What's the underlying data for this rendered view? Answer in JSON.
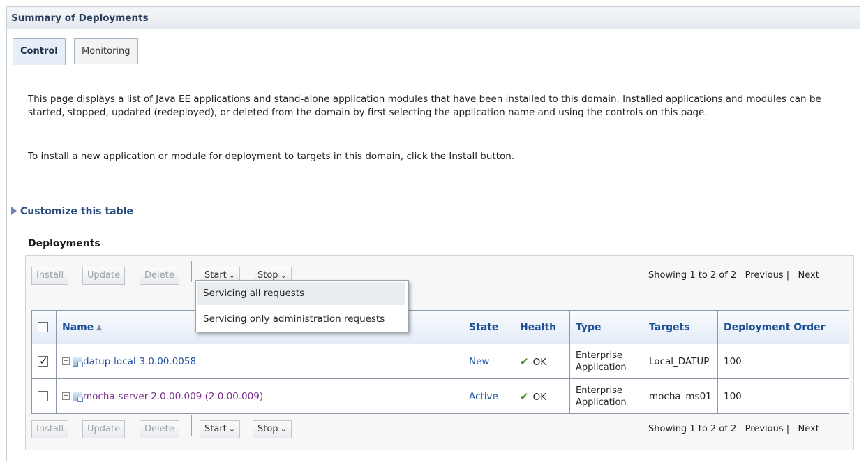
{
  "header": {
    "title": "Summary of Deployments"
  },
  "tabs": [
    {
      "label": "Control",
      "active": true
    },
    {
      "label": "Monitoring",
      "active": false
    }
  ],
  "description": {
    "paragraph1": "This page displays a list of Java EE applications and stand-alone application modules that have been installed to this domain. Installed applications and modules can be started, stopped, updated (redeployed), or deleted from the domain by first selecting the application name and using the controls on this page.",
    "paragraph2": "To install a new application or module for deployment to targets in this domain, click the Install button."
  },
  "customize_link": "Customize this table",
  "section_title": "Deployments",
  "toolbar": {
    "install": "Install",
    "update": "Update",
    "delete": "Delete",
    "start": "Start",
    "stop": "Stop",
    "chevron": "⌄"
  },
  "paging": {
    "showing": "Showing 1 to 2 of 2",
    "previous": "Previous",
    "separator": "|",
    "next": "Next"
  },
  "start_menu": {
    "items": [
      "Servicing all requests",
      "Servicing only administration requests"
    ],
    "highlighted_index": 0
  },
  "table": {
    "columns": [
      "Name",
      "State",
      "Health",
      "Type",
      "Targets",
      "Deployment Order"
    ],
    "sort_icon": "⩓",
    "rows": [
      {
        "checked": true,
        "expander": "+",
        "name": "datup-local-3.0.00.0058",
        "name_color": "blue",
        "state": "New",
        "health": "OK",
        "type": [
          "Enterprise",
          "Application"
        ],
        "targets": "Local_DATUP",
        "deployment_order": "100"
      },
      {
        "checked": false,
        "expander": "+",
        "name": "mocha-server-2.0.00.009 (2.0.00.009)",
        "name_color": "purple",
        "state": "Active",
        "health": "OK",
        "type": [
          "Enterprise",
          "Application"
        ],
        "targets": "mocha_ms01",
        "deployment_order": "100"
      }
    ]
  },
  "icons": {
    "health_ok": "check-icon",
    "expander": "plus-square-icon",
    "application": "application-icon",
    "customize": "disclosure-triangle-icon",
    "sort": "sort-ascending-icon"
  },
  "colors": {
    "link_blue": "#1d52a6",
    "link_visited": "#7a2f8c",
    "header_text": "#1e4f96",
    "ok_green": "#3f8f1a"
  }
}
